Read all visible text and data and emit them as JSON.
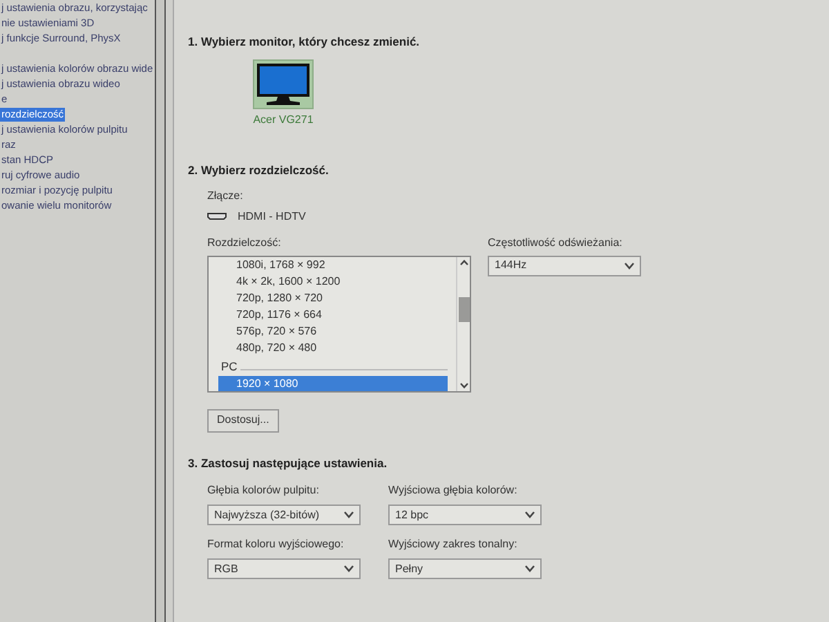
{
  "sidebar": {
    "items": [
      {
        "label": "j ustawienia obrazu, korzystając",
        "selected": false
      },
      {
        "label": "nie ustawieniami 3D",
        "selected": false
      },
      {
        "label": "j funkcje Surround, PhysX",
        "selected": false
      },
      {
        "label": "j ustawienia kolorów obrazu wide",
        "selected": false
      },
      {
        "label": "j ustawienia obrazu wideo",
        "selected": false
      },
      {
        "label": "e",
        "selected": false
      },
      {
        "label": "rozdzielczość",
        "selected": true
      },
      {
        "label": "j ustawienia kolorów pulpitu",
        "selected": false
      },
      {
        "label": "raz",
        "selected": false
      },
      {
        "label": "stan HDCP",
        "selected": false
      },
      {
        "label": "ruj cyfrowe audio",
        "selected": false
      },
      {
        "label": "rozmiar i pozycję pulpitu",
        "selected": false
      },
      {
        "label": "owanie wielu monitorów",
        "selected": false
      }
    ]
  },
  "step1": {
    "heading": "1. Wybierz monitor, który chcesz zmienić.",
    "monitor": {
      "name": "Acer VG271",
      "selected": true
    }
  },
  "step2": {
    "heading": "2. Wybierz rozdzielczość.",
    "connector_label": "Złącze:",
    "connector": "HDMI - HDTV",
    "resolution_label": "Rozdzielczość:",
    "resolutions": [
      {
        "kind": "item",
        "label": "1080i, 1768 × 992",
        "selected": false
      },
      {
        "kind": "item",
        "label": "4k × 2k, 1600 × 1200",
        "selected": false
      },
      {
        "kind": "item",
        "label": "720p, 1280 × 720",
        "selected": false
      },
      {
        "kind": "item",
        "label": "720p, 1176 × 664",
        "selected": false
      },
      {
        "kind": "item",
        "label": "576p, 720 × 576",
        "selected": false
      },
      {
        "kind": "item",
        "label": "480p, 720 × 480",
        "selected": false
      },
      {
        "kind": "group",
        "label": "PC"
      },
      {
        "kind": "item",
        "label": "1920 × 1080",
        "selected": true
      }
    ],
    "refresh_label": "Częstotliwość odświeżania:",
    "refresh_value": "144Hz",
    "customize_button": "Dostosuj..."
  },
  "step3": {
    "heading": "3. Zastosuj następujące ustawienia.",
    "fields": [
      {
        "label": "Głębia kolorów pulpitu:",
        "value": "Najwyższa (32-bitów)"
      },
      {
        "label": "Wyjściowa głębia kolorów:",
        "value": "12 bpc"
      },
      {
        "label": "Format koloru wyjściowego:",
        "value": "RGB"
      },
      {
        "label": "Wyjściowy zakres tonalny:",
        "value": "Pełny"
      }
    ]
  }
}
